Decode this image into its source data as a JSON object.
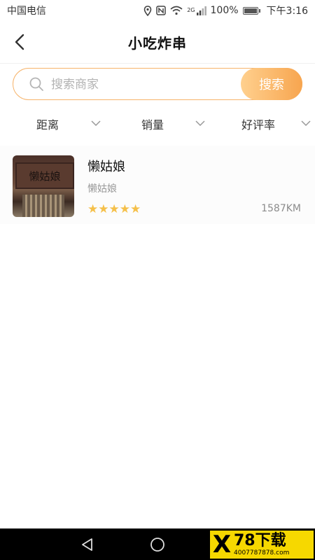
{
  "status_bar": {
    "carrier": "中国电信",
    "battery": "100%",
    "time": "下午3:16",
    "icons": [
      "location-icon",
      "nfc-icon",
      "wifi-icon",
      "signal-icon",
      "battery-icon"
    ],
    "network_badge": "2G"
  },
  "header": {
    "title": "小吃炸串",
    "back_icon": "chevron-left-icon"
  },
  "search": {
    "placeholder": "搜索商家",
    "value": "",
    "button_label": "搜索",
    "accent_color": "#f7a54f"
  },
  "filters": [
    {
      "label": "距离",
      "icon": "chevron-down-icon"
    },
    {
      "label": "销量",
      "icon": "chevron-down-icon"
    },
    {
      "label": "好评率",
      "icon": "chevron-down-icon"
    }
  ],
  "shops": [
    {
      "name": "懒姑娘",
      "subtitle": "懒姑娘",
      "rating": 5,
      "rating_max": 5,
      "distance": "1587KM",
      "image_sign_text": "懒姑娘"
    }
  ],
  "nav_bar": {
    "buttons": [
      "back-triangle-icon",
      "home-circle-icon"
    ],
    "watermark": {
      "mark": "X",
      "text": "78下载",
      "phone": "4007787878.com"
    }
  }
}
